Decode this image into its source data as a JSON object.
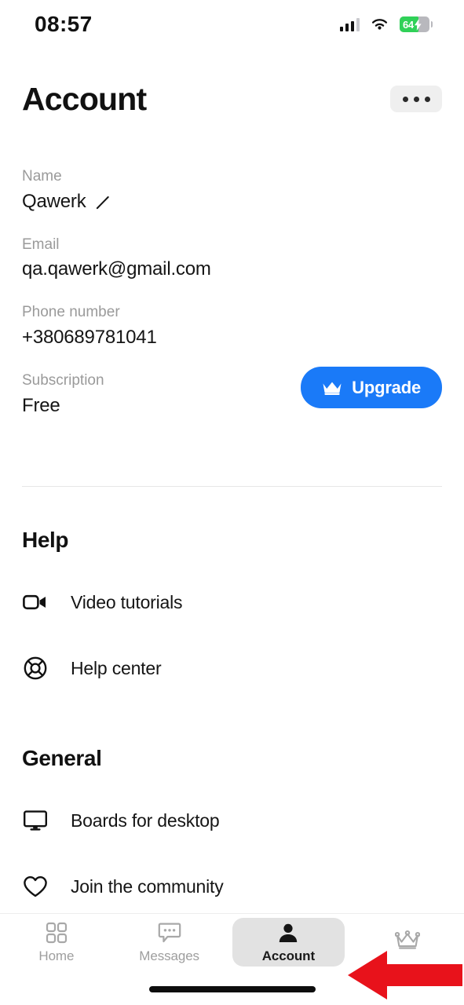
{
  "statusbar": {
    "time": "08:57",
    "battery_percent": "64",
    "battery_level": 64,
    "icons": [
      "cellular-signal-icon",
      "wifi-icon",
      "battery-charging-icon"
    ]
  },
  "header": {
    "title": "Account",
    "more_button_label": "..."
  },
  "account": {
    "fields": [
      {
        "label": "Name",
        "value": "Qawerk",
        "has_edit": true
      },
      {
        "label": "Email",
        "value": "qa.qawerk@gmail.com",
        "has_edit": false
      },
      {
        "label": "Phone number",
        "value": "+380689781041",
        "has_edit": false
      },
      {
        "label": "Subscription",
        "value": "Free",
        "has_edit": false
      }
    ],
    "upgrade_button": {
      "label": "Upgrade",
      "icon": "crown-icon",
      "color": "#1A7AF8"
    }
  },
  "sections": [
    {
      "title": "Help",
      "rows": [
        {
          "label": "Video tutorials",
          "icon": "video-camera-icon"
        },
        {
          "label": "Help center",
          "icon": "lifebuoy-icon"
        }
      ]
    },
    {
      "title": "General",
      "rows": [
        {
          "label": "Boards for desktop",
          "icon": "monitor-icon"
        },
        {
          "label": "Join the community",
          "icon": "heart-icon"
        }
      ]
    }
  ],
  "tabbar": {
    "items": [
      {
        "label": "Home",
        "icon": "grid-icon",
        "active": false
      },
      {
        "label": "Messages",
        "icon": "chat-bubble-icon",
        "active": false
      },
      {
        "label": "Account",
        "icon": "person-icon",
        "active": true
      },
      {
        "label": "",
        "icon": "crown-icon",
        "active": false
      }
    ],
    "active_background": "#E2E2E2",
    "inactive_color": "#9e9e9e"
  },
  "annotation": {
    "arrow_color": "#E8121B",
    "arrow_direction": "left",
    "points_at": "tab-account"
  }
}
